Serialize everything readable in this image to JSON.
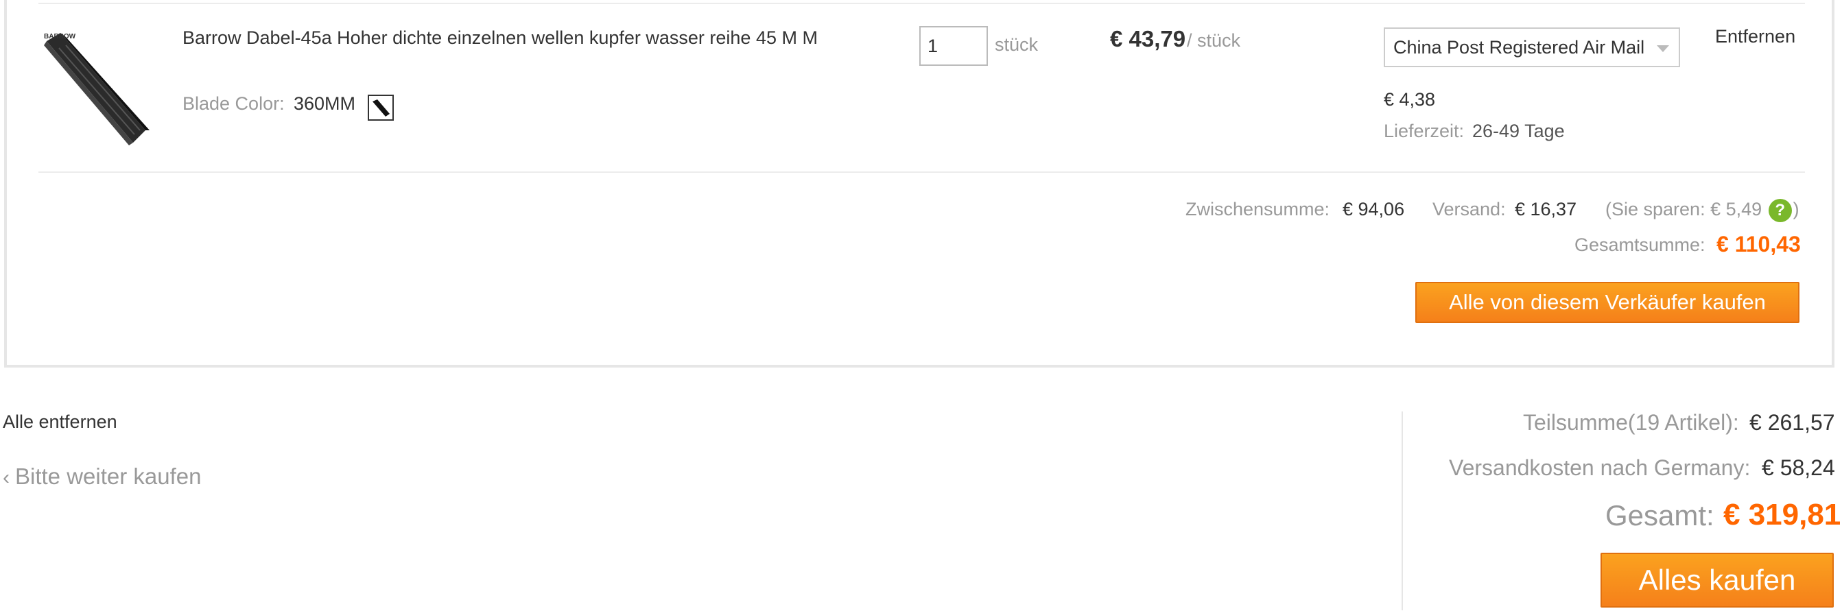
{
  "item": {
    "title": "Barrow Dabel-45a Hoher dichte einzelnen wellen kupfer wasser reihe 45 M M",
    "attr_label": "Blade Color:",
    "attr_value": "360MM",
    "quantity": "1",
    "quantity_unit": "stück",
    "price": "€ 43,79",
    "price_unit": "/ stück",
    "shipping_method": "China Post Registered Air Mail",
    "shipping_cost": "€ 4,38",
    "delivery_label": "Lieferzeit:",
    "delivery_value": "26-49 Tage",
    "remove_label": "Entfernen",
    "thumbnail_brand": "BARROW"
  },
  "seller_summary": {
    "subtotal_label": "Zwischensumme:",
    "subtotal_value": "€ 94,06",
    "shipping_label": "Versand:",
    "shipping_value": "€ 16,37",
    "savings_open": "(Sie sparen: € 5,49",
    "savings_close": ")",
    "help_icon_glyph": "?",
    "total_label": "Gesamtsumme:",
    "total_value": "€ 110,43",
    "buy_button": "Alle von diesem Verkäufer kaufen"
  },
  "footer": {
    "remove_all": "Alle entfernen",
    "continue_shopping": "Bitte weiter kaufen",
    "partial_label": "Teilsumme(19 Artikel):",
    "partial_value": "€ 261,57",
    "shipping_label": "Versandkosten nach Germany:",
    "shipping_value": "€ 58,24",
    "grand_label": "Gesamt:",
    "grand_value": "€ 319,81",
    "buy_all_button": "Alles kaufen"
  },
  "colors": {
    "accent_orange": "#f60",
    "button_orange": "#f7921e",
    "help_green": "#7ab82b"
  },
  "icons": {
    "help": "question-circle-icon",
    "continue": "chevron-left-icon",
    "dropdown": "caret-down-icon"
  }
}
